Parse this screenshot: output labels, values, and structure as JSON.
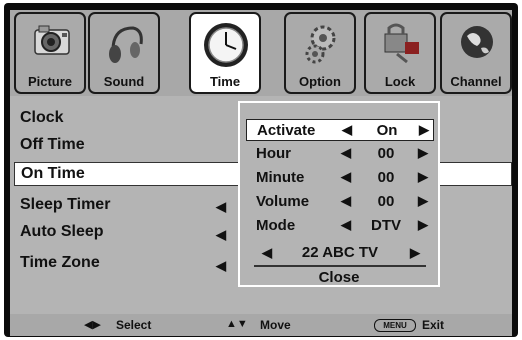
{
  "tabs": [
    {
      "label": "Picture",
      "icon": "camera-icon"
    },
    {
      "label": "Sound",
      "icon": "headphones-icon"
    },
    {
      "label": "Time",
      "icon": "clock-icon"
    },
    {
      "label": "Option",
      "icon": "gear-icon"
    },
    {
      "label": "Lock",
      "icon": "padlock-icon"
    },
    {
      "label": "Channel",
      "icon": "globe-icon"
    }
  ],
  "active_tab": "Time",
  "menu": {
    "items": [
      "Clock",
      "Off Time",
      "On Time",
      "Sleep Timer",
      "Auto Sleep",
      "Time Zone"
    ],
    "selected": "On Time"
  },
  "popup": {
    "rows": [
      {
        "label": "Activate",
        "value": "On"
      },
      {
        "label": "Hour",
        "value": "00"
      },
      {
        "label": "Minute",
        "value": "00"
      },
      {
        "label": "Volume",
        "value": "00"
      },
      {
        "label": "Mode",
        "value": "DTV"
      }
    ],
    "channel": "22 ABC TV",
    "close_label": "Close"
  },
  "footer": {
    "select": "Select",
    "move": "Move",
    "menu_key": "MENU",
    "exit": "Exit"
  },
  "arrows": {
    "left": "◀",
    "right": "▶"
  }
}
